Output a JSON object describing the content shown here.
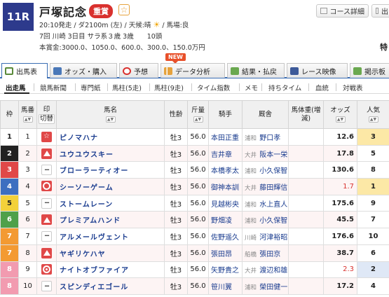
{
  "race": {
    "number": "11R",
    "name": "戸塚記念",
    "grade": "重賞",
    "info_line1": "20:10発走 / ダ2100m (左) / 天候:晴",
    "track_cond": "/ 馬場:良",
    "info_line2": "7回 川崎 3日目 サラ系３歳 3歳　　10頭",
    "info_line3": "本賞金:3000.0、1050.0、600.0、300.0、150.0万円",
    "special": "特"
  },
  "top_buttons": {
    "course": "コース詳細",
    "export": "出"
  },
  "tabs": [
    {
      "label": "出馬表",
      "icon": "table-icon",
      "color": "#5a8a3a"
    },
    {
      "label": "オッズ・購入",
      "icon": "odds-icon",
      "color": "#4a78b8"
    },
    {
      "label": "予想",
      "icon": "target-icon",
      "color": "#d9312e"
    },
    {
      "label": "データ分析",
      "icon": "chart-icon",
      "color": "#e6a23c"
    },
    {
      "label": "結果・払戻",
      "icon": "result-icon",
      "color": "#6aa84f"
    },
    {
      "label": "レース映像",
      "icon": "video-icon",
      "color": "#3d5a99"
    },
    {
      "label": "掲示板",
      "icon": "board-icon",
      "color": "#6aa84f"
    }
  ],
  "new_badge": "NEW",
  "subtabs": [
    "出走馬",
    "競馬新聞",
    "専門紙",
    "馬柱(5走)",
    "馬柱(9走)",
    "タイム指数",
    "メモ",
    "持ちタイム",
    "血統",
    "対戦表"
  ],
  "table": {
    "headers": {
      "waku": "枠",
      "umaban": "馬番",
      "mark": "印",
      "mark_sub": "切替",
      "horse": "馬名",
      "sex": "性齢",
      "weight": "斤量",
      "jockey": "騎手",
      "trainer": "厩舎",
      "body": "馬体重(増減)",
      "odds": "オッズ",
      "pop": "人気"
    },
    "rows": [
      {
        "waku": "1",
        "umaban": "1",
        "mark": "star",
        "horse": "ピノマハナ",
        "sex": "牡3",
        "weight": "56.0",
        "jockey": "本田正重",
        "stable": "浦和",
        "trainer": "野口孝",
        "odds": "12.6",
        "fav": false,
        "pop": "3",
        "pop_bg": "#fce8a6"
      },
      {
        "waku": "2",
        "umaban": "2",
        "mark": "triangle",
        "horse": "ユウユウスキー",
        "sex": "牡3",
        "weight": "56.0",
        "jockey": "吉井章",
        "stable": "大井",
        "trainer": "阪本一栄",
        "odds": "17.8",
        "fav": false,
        "pop": "5",
        "pop_bg": "#ffffff"
      },
      {
        "waku": "3",
        "umaban": "3",
        "mark": "dash",
        "horse": "ブローラーティオー",
        "sex": "牡3",
        "weight": "56.0",
        "jockey": "本橋孝太",
        "stable": "浦和",
        "trainer": "小久保智",
        "odds": "130.6",
        "fav": false,
        "pop": "8",
        "pop_bg": "#ffffff"
      },
      {
        "waku": "4",
        "umaban": "4",
        "mark": "circle",
        "horse": "シーソーゲーム",
        "sex": "牡3",
        "weight": "56.0",
        "jockey": "御神本訓",
        "stable": "大井",
        "trainer": "藤田輝信",
        "odds": "1.7",
        "fav": true,
        "pop": "1",
        "pop_bg": "#fce8a6"
      },
      {
        "waku": "5",
        "umaban": "5",
        "mark": "dash",
        "horse": "ストームレーン",
        "sex": "牡3",
        "weight": "56.0",
        "jockey": "見越彬央",
        "stable": "浦和",
        "trainer": "水上直人",
        "odds": "175.6",
        "fav": false,
        "pop": "9",
        "pop_bg": "#ffffff"
      },
      {
        "waku": "6",
        "umaban": "6",
        "mark": "triangle",
        "horse": "プレミアムハンド",
        "sex": "牡3",
        "weight": "56.0",
        "jockey": "野畑凌",
        "stable": "浦和",
        "trainer": "小久保智",
        "odds": "45.5",
        "fav": false,
        "pop": "7",
        "pop_bg": "#ffffff"
      },
      {
        "waku": "7",
        "umaban": "7",
        "mark": "dash",
        "horse": "アルメールヴェント",
        "sex": "牡3",
        "weight": "56.0",
        "jockey": "佐野遥久",
        "stable": "川崎",
        "trainer": "河津裕昭",
        "odds": "176.6",
        "fav": false,
        "pop": "10",
        "pop_bg": "#ffffff"
      },
      {
        "waku": "7",
        "umaban": "8",
        "mark": "triangle",
        "horse": "ヤギリケハヤ",
        "sex": "牡3",
        "weight": "56.0",
        "jockey": "張田昂",
        "stable": "船橋",
        "trainer": "張田京",
        "odds": "38.7",
        "fav": false,
        "pop": "6",
        "pop_bg": "#ffffff"
      },
      {
        "waku": "8",
        "umaban": "9",
        "mark": "double-circle",
        "horse": "ナイトオブファイア",
        "sex": "牡3",
        "weight": "56.0",
        "jockey": "矢野貴之",
        "stable": "大井",
        "trainer": "渡辺和雄",
        "odds": "2.3",
        "fav": true,
        "pop": "2",
        "pop_bg": "#dfe8f6"
      },
      {
        "waku": "8",
        "umaban": "10",
        "mark": "dash",
        "horse": "スピンディエゴール",
        "sex": "牡3",
        "weight": "56.0",
        "jockey": "笹川翼",
        "stable": "浦和",
        "trainer": "榮田健一",
        "odds": "17.2",
        "fav": false,
        "pop": "4",
        "pop_bg": "#ffffff"
      }
    ]
  },
  "waku_colors": {
    "1": {
      "bg": "#ffffff",
      "fg": "#222222"
    },
    "2": {
      "bg": "#222222",
      "fg": "#ffffff"
    },
    "3": {
      "bg": "#e04848",
      "fg": "#ffffff"
    },
    "4": {
      "bg": "#3d6fc0",
      "fg": "#ffffff"
    },
    "5": {
      "bg": "#f3d13a",
      "fg": "#222222"
    },
    "6": {
      "bg": "#4ea04a",
      "fg": "#ffffff"
    },
    "7": {
      "bg": "#f39a32",
      "fg": "#ffffff"
    },
    "8": {
      "bg": "#f29bb0",
      "fg": "#ffffff"
    }
  }
}
